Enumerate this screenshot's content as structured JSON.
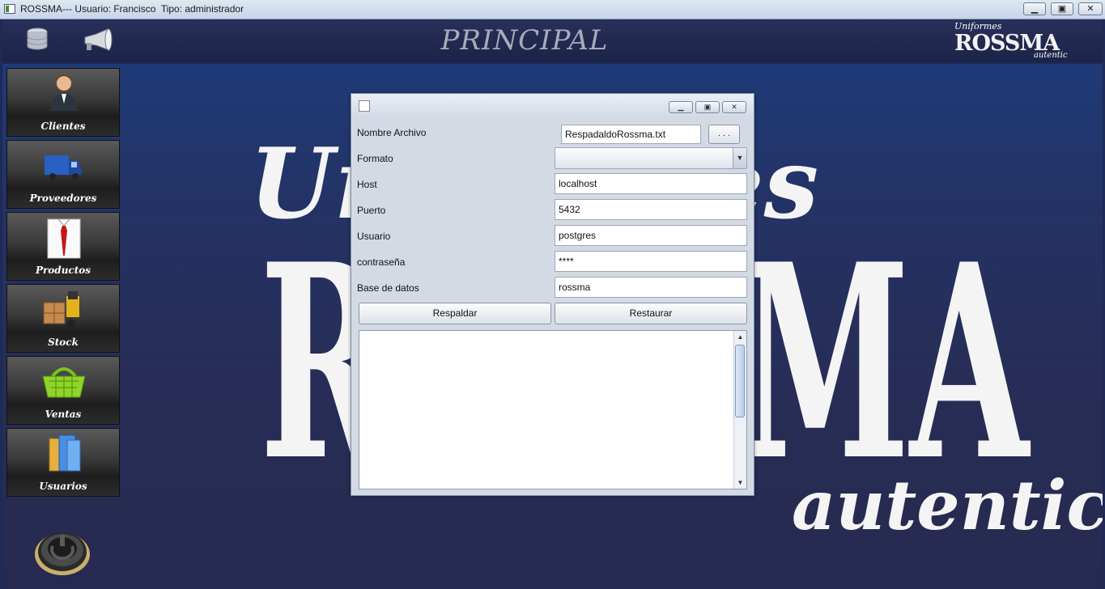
{
  "window": {
    "title": "ROSSMA--- Usuario: Francisco  Tipo: administrador",
    "minimize_glyph": "▁",
    "maximize_glyph": "▣",
    "close_glyph": "✕"
  },
  "header": {
    "title": "PRINCIPAL",
    "logo": {
      "top": "Uniformes",
      "main": "ROSSMA",
      "bottom": "autentic"
    }
  },
  "sidebar": {
    "items": [
      {
        "label": "Clientes",
        "icon": "client-icon"
      },
      {
        "label": "Proveedores",
        "icon": "truck-icon"
      },
      {
        "label": "Productos",
        "icon": "shirt-icon"
      },
      {
        "label": "Stock",
        "icon": "forklift-icon"
      },
      {
        "label": "Ventas",
        "icon": "basket-icon"
      },
      {
        "label": "Usuarios",
        "icon": "folders-icon"
      }
    ]
  },
  "background_logo": {
    "line1": "Uniformes",
    "line2": "ROSSMA",
    "line3": "autentic"
  },
  "dialog": {
    "fields": {
      "nombre_archivo": {
        "label": "Nombre Archivo",
        "value": "RespadaldoRossma.txt"
      },
      "browse_label": ". . .",
      "formato": {
        "label": "Formato",
        "value": ""
      },
      "host": {
        "label": "Host",
        "value": "localhost"
      },
      "puerto": {
        "label": "Puerto",
        "value": "5432"
      },
      "usuario": {
        "label": "Usuario",
        "value": "postgres"
      },
      "contrasena": {
        "label": "contraseña",
        "value": "****"
      },
      "base_datos": {
        "label": "Base de datos",
        "value": "rossma"
      }
    },
    "buttons": {
      "respaldar": "Respaldar",
      "restaurar": "Restaurar"
    },
    "log_text": ""
  },
  "colors": {
    "header_bg": "#1c2348",
    "main_bg": "#272d56",
    "dialog_bg": "#d4dae4",
    "sidebar_btn": "#3a3a3a"
  }
}
